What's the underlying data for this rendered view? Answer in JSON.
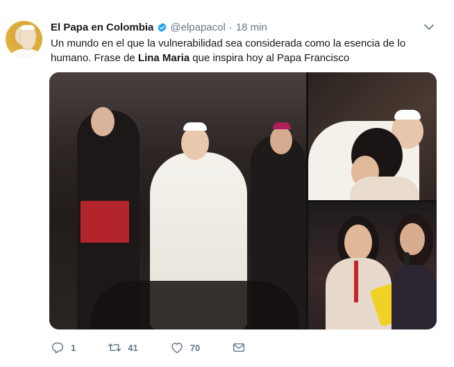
{
  "account": {
    "name": "El Papa en Colombia",
    "handle": "@elpapacol",
    "separator": "·",
    "time": "18 min",
    "verified_color": "#1da1f2"
  },
  "tweet": {
    "text_part1": "Un mundo en el que la vulnerabilidad sea considerada como la esencia de lo humano. Frase de ",
    "text_bold": "Lina Maria",
    "text_part2": " que inspira hoy al Papa Francisco"
  },
  "actions": {
    "reply_count": "1",
    "retweet_count": "41",
    "like_count": "70"
  },
  "icons": {
    "verified": "verified-badge-icon",
    "caret": "chevron-down-icon",
    "reply": "reply-icon",
    "retweet": "retweet-icon",
    "like": "heart-icon",
    "dm": "envelope-icon"
  },
  "colors": {
    "text": "#14171a",
    "secondary": "#657786",
    "accent": "#1da1f2"
  }
}
